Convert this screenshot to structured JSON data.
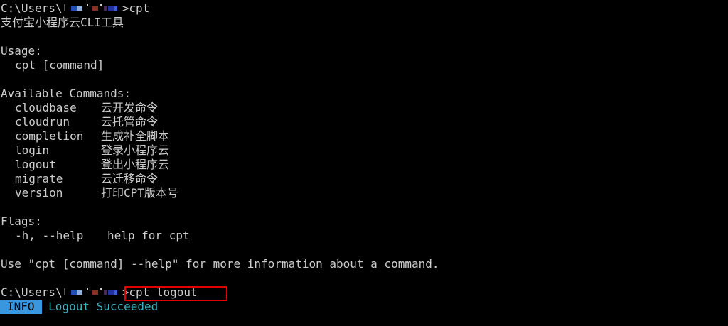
{
  "terminal": {
    "prompt_prefix": "C:\\Users\\",
    "prompt_suffix": ">",
    "first_command": "cpt",
    "description": "支付宝小程序云CLI工具",
    "usage_heading": "Usage:",
    "usage_line": "cpt [command]",
    "commands_heading": "Available Commands:",
    "commands": [
      {
        "name": "cloudbase",
        "desc": "云开发命令"
      },
      {
        "name": "cloudrun",
        "desc": "云托管命令"
      },
      {
        "name": "completion",
        "desc": "生成补全脚本"
      },
      {
        "name": "login",
        "desc": "登录小程序云"
      },
      {
        "name": "logout",
        "desc": "登出小程序云"
      },
      {
        "name": "migrate",
        "desc": "云迁移命令"
      },
      {
        "name": "version",
        "desc": "打印CPT版本号"
      }
    ],
    "flags_heading": "Flags:",
    "flag_name": "-h, --help",
    "flag_desc": "help for cpt",
    "help_hint": "Use \"cpt [command] --help\" for more information about a command.",
    "second_command": "cpt logout",
    "log_level": "INFO",
    "log_message": "Logout Succeeded"
  },
  "colors": {
    "background": "#000000",
    "text": "#cccccc",
    "info_badge": "#3a96dd",
    "success_text": "#3ab4bf",
    "highlight_border": "#e30000"
  }
}
